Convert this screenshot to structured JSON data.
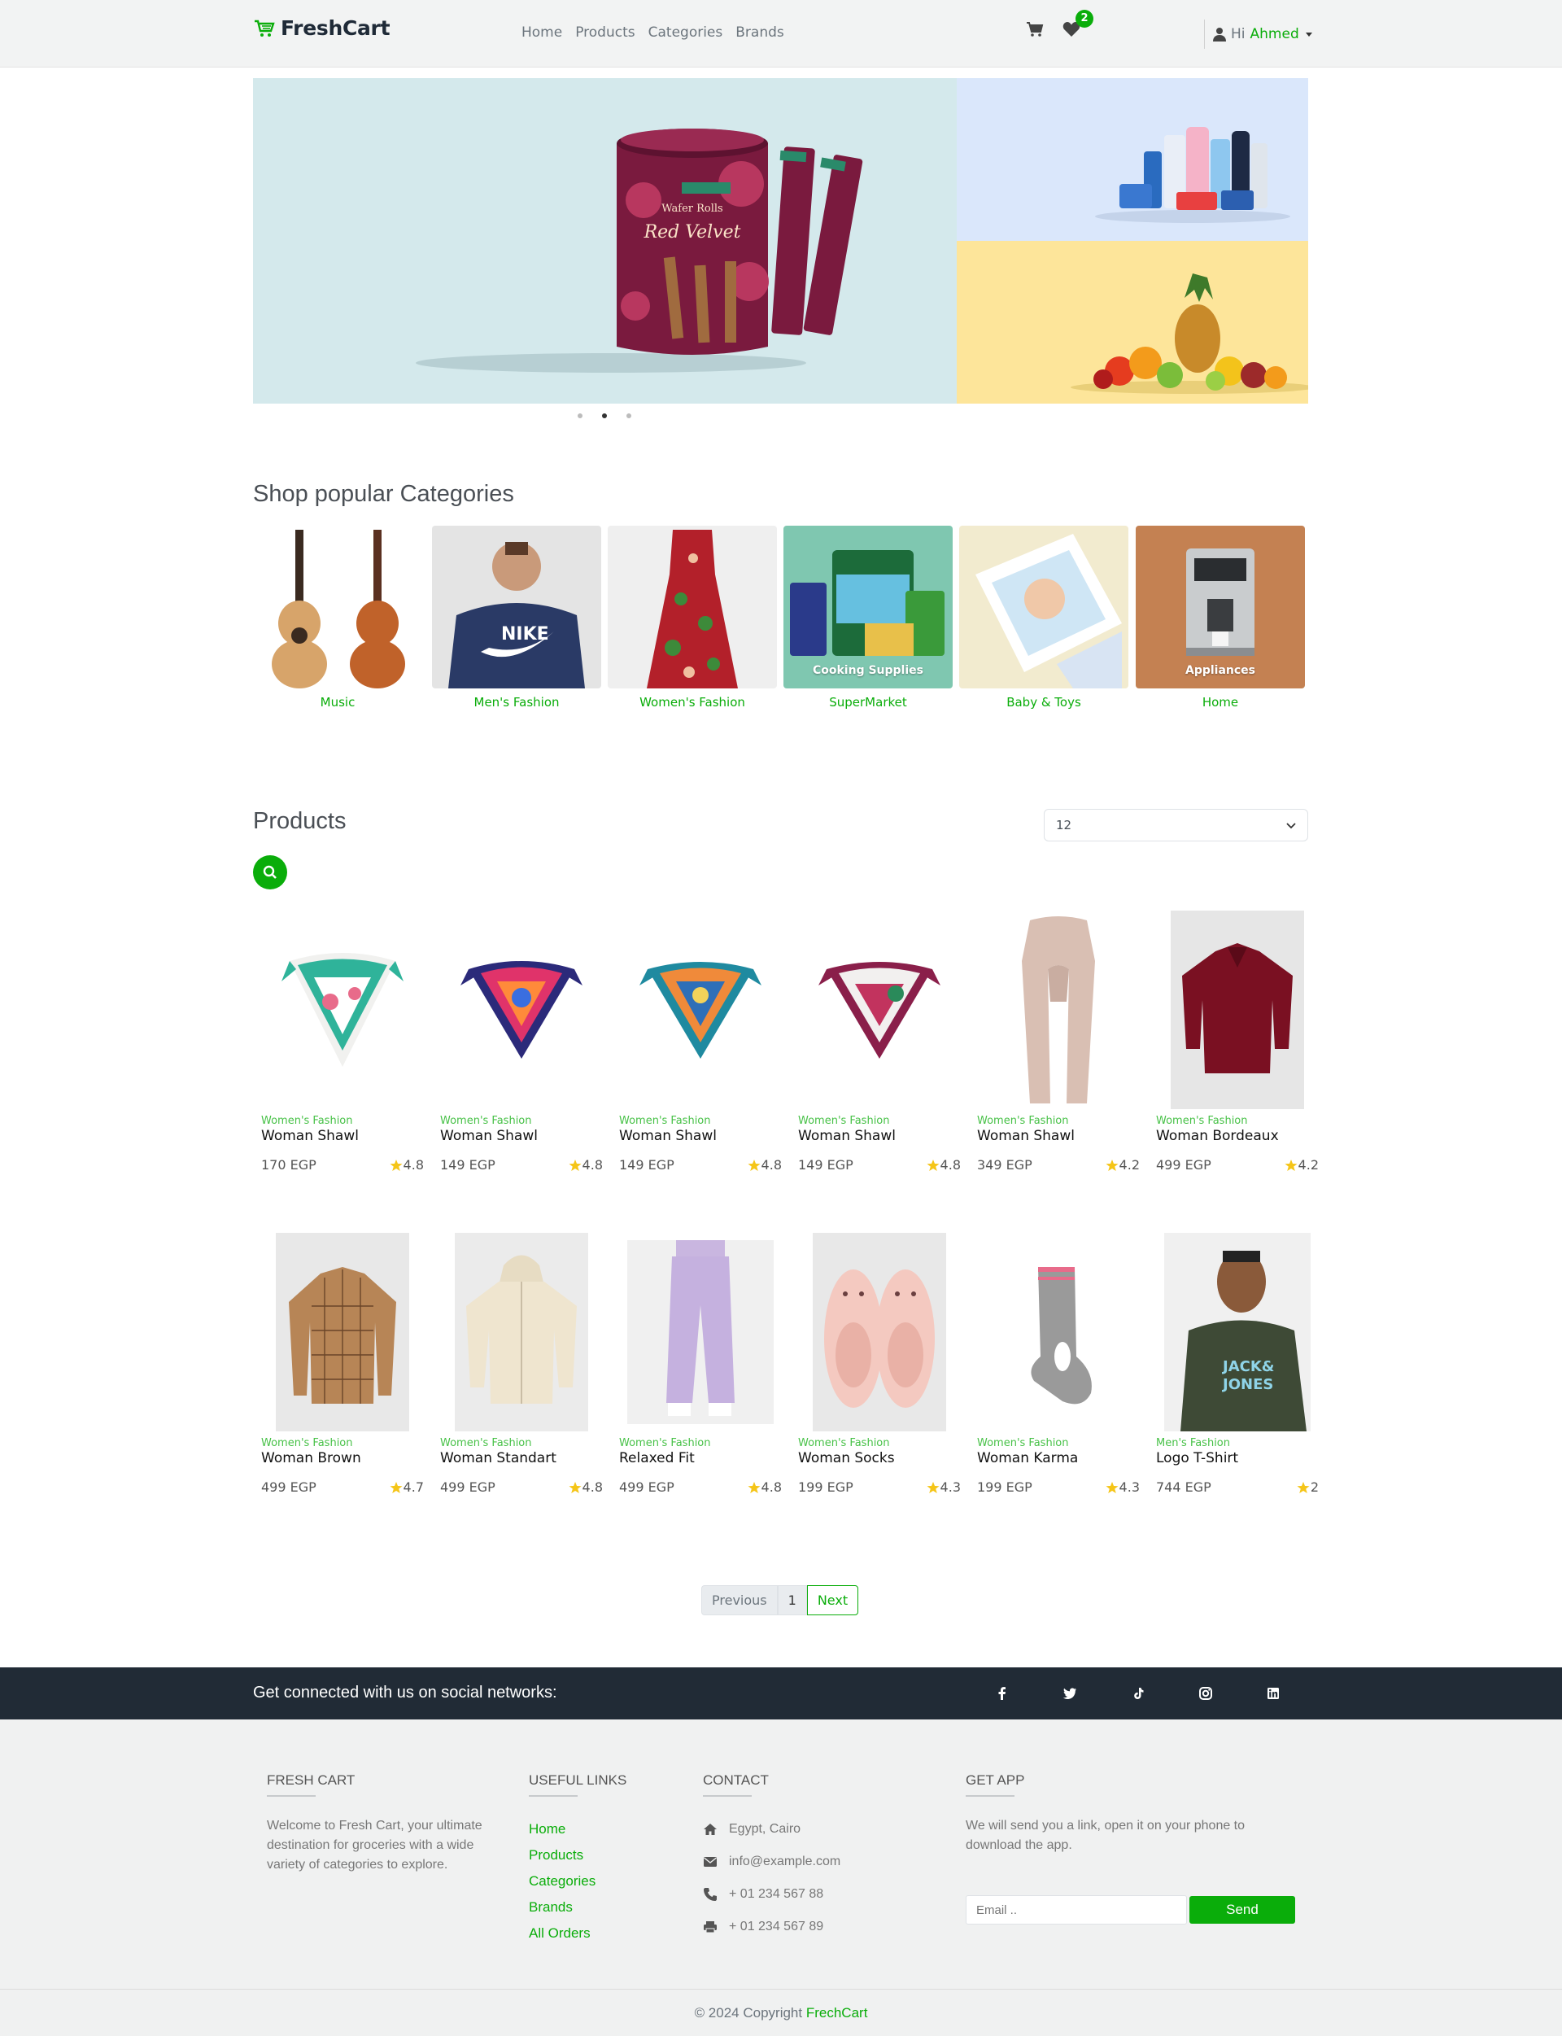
{
  "colors": {
    "accent": "#0aad0a",
    "navbar_bg": "#f2f3f3",
    "footer_dark": "#212b36",
    "footer_bg": "#f0f1f1",
    "star": "#f5c518"
  },
  "navbar": {
    "brand": "FreshCart",
    "links": [
      "Home",
      "Products",
      "Categories",
      "Brands"
    ],
    "wishlist_count": "2",
    "user_greeting": "Hi",
    "user_name": "Ahmed"
  },
  "slider": {
    "slides": 3,
    "active_index": 1
  },
  "categories_section": {
    "title": "Shop popular Categories",
    "items": [
      {
        "name": "Music",
        "overlay": ""
      },
      {
        "name": "Men's Fashion",
        "overlay": ""
      },
      {
        "name": "Women's Fashion",
        "overlay": ""
      },
      {
        "name": "SuperMarket",
        "overlay": "Cooking Supplies"
      },
      {
        "name": "Baby & Toys",
        "overlay": ""
      },
      {
        "name": "Home",
        "overlay": "Appliances"
      }
    ]
  },
  "products_section": {
    "title": "Products",
    "limit_value": "12",
    "items": [
      {
        "category": "Women's Fashion",
        "name": "Woman Shawl",
        "price": "170 EGP",
        "rating": "4.8"
      },
      {
        "category": "Women's Fashion",
        "name": "Woman Shawl",
        "price": "149 EGP",
        "rating": "4.8"
      },
      {
        "category": "Women's Fashion",
        "name": "Woman Shawl",
        "price": "149 EGP",
        "rating": "4.8"
      },
      {
        "category": "Women's Fashion",
        "name": "Woman Shawl",
        "price": "149 EGP",
        "rating": "4.8"
      },
      {
        "category": "Women's Fashion",
        "name": "Woman Shawl",
        "price": "349 EGP",
        "rating": "4.2"
      },
      {
        "category": "Women's Fashion",
        "name": "Woman Bordeaux",
        "price": "499 EGP",
        "rating": "4.2"
      },
      {
        "category": "Women's Fashion",
        "name": "Woman Brown",
        "price": "499 EGP",
        "rating": "4.7"
      },
      {
        "category": "Women's Fashion",
        "name": "Woman Standart",
        "price": "499 EGP",
        "rating": "4.8"
      },
      {
        "category": "Women's Fashion",
        "name": "Relaxed Fit",
        "price": "499 EGP",
        "rating": "4.8"
      },
      {
        "category": "Women's Fashion",
        "name": "Woman Socks",
        "price": "199 EGP",
        "rating": "4.3"
      },
      {
        "category": "Women's Fashion",
        "name": "Woman Karma",
        "price": "199 EGP",
        "rating": "4.3"
      },
      {
        "category": "Men's Fashion",
        "name": "Logo T-Shirt",
        "price": "744 EGP",
        "rating": "2"
      }
    ]
  },
  "pagination": {
    "previous": "Previous",
    "current": "1",
    "next": "Next"
  },
  "social_bar": {
    "text": "Get connected with us on social networks:",
    "icons": [
      "facebook-icon",
      "twitter-icon",
      "tiktok-icon",
      "instagram-icon",
      "linkedin-icon"
    ]
  },
  "footer": {
    "about": {
      "heading": "FRESH CART",
      "text": "Welcome to Fresh Cart, your ultimate destination for groceries with a wide variety of categories to explore."
    },
    "links": {
      "heading": "USEFUL LINKS",
      "items": [
        "Home",
        "Products",
        "Categories",
        "Brands",
        "All Orders"
      ]
    },
    "contact": {
      "heading": "CONTACT",
      "address": "Egypt, Cairo",
      "email": "info@example.com",
      "phone": "+ 01 234 567 88",
      "fax": "+ 01 234 567 89"
    },
    "app": {
      "heading": "GET APP",
      "text": "We will send you a link, open it on your phone to download the app.",
      "email_placeholder": "Email ..",
      "send_label": "Send"
    }
  },
  "copyright": {
    "prefix": "© 2024 Copyright",
    "brand": "FrechCart"
  }
}
